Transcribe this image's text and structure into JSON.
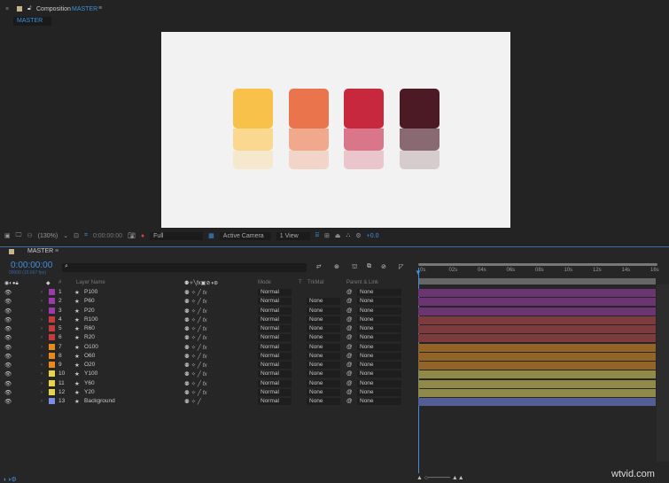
{
  "panel": {
    "close": "×",
    "title_prefix": "Composition",
    "comp_name": "MASTER",
    "tab": "MASTER",
    "menu": "≡"
  },
  "preview": {
    "columns": [
      {
        "color": "#f8c24a",
        "mid": "#fad88f",
        "low": "#f6e8cc"
      },
      {
        "color": "#ea744b",
        "mid": "#f0a98d",
        "low": "#f3d4c8"
      },
      {
        "color": "#c8283e",
        "mid": "#d9768a",
        "low": "#eac6cc"
      },
      {
        "color": "#4b1a25",
        "mid": "#8a6a72",
        "low": "#d6cbcd"
      }
    ]
  },
  "viewer_toolbar": {
    "zoom": "(130%)",
    "timecode": "0:00:00:00",
    "resolution": "Full",
    "camera": "Active Camera",
    "views": "1 View",
    "exposure": "+0.0"
  },
  "timeline": {
    "tab": "MASTER",
    "timecode": "0:00:00:00",
    "frame_info": "00000 (16.667 fps)",
    "search_placeholder": "",
    "headers": {
      "num": "#",
      "layer_name": "Layer Name",
      "mode": "Mode",
      "t": "T",
      "trkmat": "TrkMat",
      "parent": "Parent & Link"
    },
    "ruler": [
      "0s",
      "02s",
      "04s",
      "06s",
      "08s",
      "10s",
      "12s",
      "14s",
      "16s"
    ],
    "layers": [
      {
        "num": "1",
        "name": "P100",
        "label": "#9b3aa8",
        "bar": "#6a3570",
        "mode": "Normal",
        "trkmat": "",
        "parent": "None",
        "fx": true
      },
      {
        "num": "2",
        "name": "P60",
        "label": "#9b3aa8",
        "bar": "#6a3570",
        "mode": "Normal",
        "trkmat": "None",
        "parent": "None",
        "fx": true
      },
      {
        "num": "3",
        "name": "P20",
        "label": "#9b3aa8",
        "bar": "#6a3570",
        "mode": "Normal",
        "trkmat": "None",
        "parent": "None",
        "fx": true
      },
      {
        "num": "4",
        "name": "R100",
        "label": "#c43c3c",
        "bar": "#7e3b3e",
        "mode": "Normal",
        "trkmat": "None",
        "parent": "None",
        "fx": true
      },
      {
        "num": "5",
        "name": "R60",
        "label": "#c43c3c",
        "bar": "#7e3b3e",
        "mode": "Normal",
        "trkmat": "None",
        "parent": "None",
        "fx": true
      },
      {
        "num": "6",
        "name": "R20",
        "label": "#c43c3c",
        "bar": "#7e3b3e",
        "mode": "Normal",
        "trkmat": "None",
        "parent": "None",
        "fx": true
      },
      {
        "num": "7",
        "name": "O100",
        "label": "#e88a1a",
        "bar": "#936428",
        "mode": "Normal",
        "trkmat": "None",
        "parent": "None",
        "fx": true
      },
      {
        "num": "8",
        "name": "O60",
        "label": "#e88a1a",
        "bar": "#936428",
        "mode": "Normal",
        "trkmat": "None",
        "parent": "None",
        "fx": true
      },
      {
        "num": "9",
        "name": "O20",
        "label": "#e88a1a",
        "bar": "#936428",
        "mode": "Normal",
        "trkmat": "None",
        "parent": "None",
        "fx": true
      },
      {
        "num": "10",
        "name": "Y100",
        "label": "#e8d44a",
        "bar": "#908a48",
        "mode": "Normal",
        "trkmat": "None",
        "parent": "None",
        "fx": true
      },
      {
        "num": "11",
        "name": "Y60",
        "label": "#e8d44a",
        "bar": "#908a48",
        "mode": "Normal",
        "trkmat": "None",
        "parent": "None",
        "fx": true
      },
      {
        "num": "12",
        "name": "Y20",
        "label": "#e8d44a",
        "bar": "#908a48",
        "mode": "Normal",
        "trkmat": "None",
        "parent": "None",
        "fx": true
      },
      {
        "num": "13",
        "name": "Background",
        "label": "#7a8ee8",
        "bar": "#535f94",
        "mode": "Normal",
        "trkmat": "None",
        "parent": "None",
        "fx": false
      }
    ]
  },
  "watermark": "wtvid.com"
}
